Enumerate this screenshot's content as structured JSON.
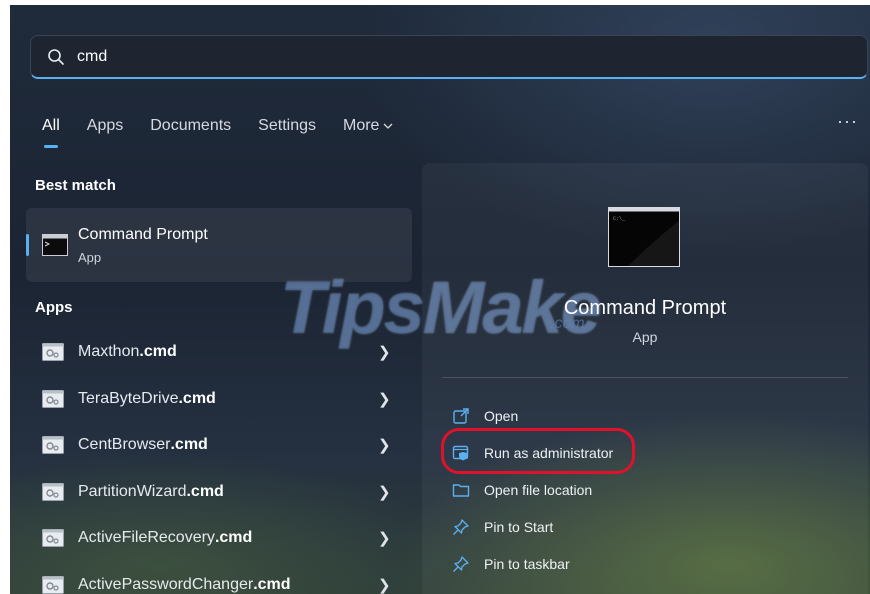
{
  "search": {
    "value": "cmd",
    "icon": "search-icon"
  },
  "tabs": [
    {
      "label": "All",
      "active": true
    },
    {
      "label": "Apps",
      "active": false
    },
    {
      "label": "Documents",
      "active": false
    },
    {
      "label": "Settings",
      "active": false
    },
    {
      "label": "More",
      "active": false
    }
  ],
  "overflow_label": "···",
  "best_match": {
    "heading": "Best match",
    "name": "Command Prompt",
    "type": "App"
  },
  "apps": {
    "heading": "Apps",
    "items": [
      {
        "prefix": "Maxthon",
        "suffix": ".cmd"
      },
      {
        "prefix": "TeraByteDrive",
        "suffix": ".cmd"
      },
      {
        "prefix": "CentBrowser",
        "suffix": ".cmd"
      },
      {
        "prefix": "PartitionWizard",
        "suffix": ".cmd"
      },
      {
        "prefix": "ActiveFileRecovery",
        "suffix": ".cmd"
      },
      {
        "prefix": "ActivePasswordChanger",
        "suffix": ".cmd"
      }
    ]
  },
  "detail": {
    "title": "Command Prompt",
    "type": "App",
    "actions": [
      {
        "label": "Open",
        "icon": "open-icon"
      },
      {
        "label": "Run as administrator",
        "icon": "shield-window-icon"
      },
      {
        "label": "Open file location",
        "icon": "folder-icon"
      },
      {
        "label": "Pin to Start",
        "icon": "pin-icon"
      },
      {
        "label": "Pin to taskbar",
        "icon": "pin-icon"
      }
    ]
  },
  "watermark": {
    "main": "TipsMake",
    "suffix": ".com"
  },
  "colors": {
    "accent": "#5ab0f0",
    "highlight": "#e0112b"
  }
}
